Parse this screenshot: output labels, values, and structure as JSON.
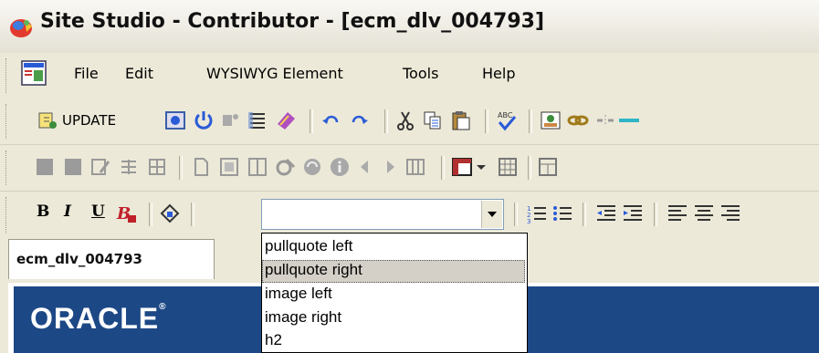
{
  "window": {
    "title": "Site Studio - Contributor - [ecm_dlv_004793]"
  },
  "menu": {
    "items": [
      {
        "label": "File"
      },
      {
        "label": "Edit"
      },
      {
        "label": "WYSIWYG Element"
      },
      {
        "label": "Tools"
      },
      {
        "label": "Help"
      }
    ]
  },
  "toolbar": {
    "update_label": "UPDATE"
  },
  "format_bar": {
    "bold": "B",
    "italic": "I",
    "underline": "U",
    "style_value": "",
    "style_options": [
      {
        "label": "pullquote left"
      },
      {
        "label": "pullquote right"
      },
      {
        "label": "image left"
      },
      {
        "label": "image right"
      },
      {
        "label": "h2"
      }
    ]
  },
  "document": {
    "tab_label": "ecm_dlv_004793"
  },
  "colors": {
    "banner": "#1d4886",
    "accent_blue": "#2a5bd7"
  }
}
